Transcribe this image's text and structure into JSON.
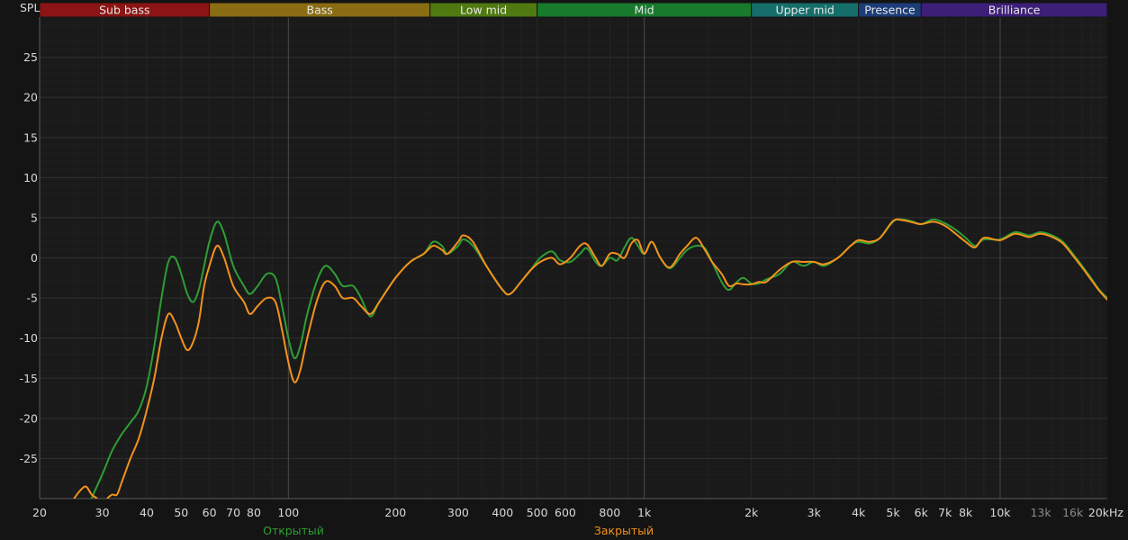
{
  "chart_data": {
    "type": "line",
    "y_axis_label": "SPL",
    "x_scale": "log",
    "xlim": [
      20,
      20000
    ],
    "ylim": [
      -30,
      30
    ],
    "grid": true,
    "bands": [
      {
        "label": "Sub bass",
        "from": 20,
        "to": 60,
        "color": "#8c1414"
      },
      {
        "label": "Bass",
        "from": 60,
        "to": 250,
        "color": "#8a6d12"
      },
      {
        "label": "Low mid",
        "from": 250,
        "to": 500,
        "color": "#4f7a12"
      },
      {
        "label": "Mid",
        "from": 500,
        "to": 2000,
        "color": "#187a2c"
      },
      {
        "label": "Upper mid",
        "from": 2000,
        "to": 4000,
        "color": "#156e6a"
      },
      {
        "label": "Presence",
        "from": 4000,
        "to": 6000,
        "color": "#1c3d78"
      },
      {
        "label": "Brilliance",
        "from": 6000,
        "to": 20000,
        "color": "#3d1f78"
      }
    ],
    "x_ticks": [
      {
        "value": 20,
        "label": "20"
      },
      {
        "value": 30,
        "label": "30"
      },
      {
        "value": 40,
        "label": "40"
      },
      {
        "value": 50,
        "label": "50"
      },
      {
        "value": 60,
        "label": "60"
      },
      {
        "value": 70,
        "label": "70"
      },
      {
        "value": 80,
        "label": "80"
      },
      {
        "value": 100,
        "label": "100"
      },
      {
        "value": 200,
        "label": "200"
      },
      {
        "value": 300,
        "label": "300"
      },
      {
        "value": 400,
        "label": "400"
      },
      {
        "value": 500,
        "label": "500"
      },
      {
        "value": 600,
        "label": "600"
      },
      {
        "value": 800,
        "label": "800"
      },
      {
        "value": 1000,
        "label": "1k"
      },
      {
        "value": 2000,
        "label": "2k"
      },
      {
        "value": 3000,
        "label": "3k"
      },
      {
        "value": 4000,
        "label": "4k"
      },
      {
        "value": 5000,
        "label": "5k"
      },
      {
        "value": 6000,
        "label": "6k"
      },
      {
        "value": 7000,
        "label": "7k"
      },
      {
        "value": 8000,
        "label": "8k"
      },
      {
        "value": 10000,
        "label": "10k"
      },
      {
        "value": 13000,
        "label": "13k",
        "dim": true
      },
      {
        "value": 16000,
        "label": "16k",
        "dim": true
      },
      {
        "value": 20000,
        "label": "20kHz"
      }
    ],
    "y_ticks": [
      25,
      20,
      15,
      10,
      5,
      0,
      -5,
      -10,
      -15,
      -20,
      -25
    ],
    "series": [
      {
        "name": "Открытый",
        "color": "#2e9e35",
        "points": [
          [
            26,
            -34
          ],
          [
            28,
            -30
          ],
          [
            30,
            -27
          ],
          [
            32,
            -24
          ],
          [
            34,
            -22
          ],
          [
            36,
            -20.5
          ],
          [
            38,
            -19
          ],
          [
            40,
            -16
          ],
          [
            42,
            -11
          ],
          [
            44,
            -5
          ],
          [
            46,
            -0.5
          ],
          [
            48,
            0
          ],
          [
            50,
            -2
          ],
          [
            52,
            -4.5
          ],
          [
            54,
            -5.5
          ],
          [
            56,
            -4
          ],
          [
            58,
            -1
          ],
          [
            60,
            2
          ],
          [
            63,
            4.5
          ],
          [
            66,
            3
          ],
          [
            70,
            -1
          ],
          [
            75,
            -3.5
          ],
          [
            78,
            -4.5
          ],
          [
            82,
            -3.5
          ],
          [
            87,
            -2
          ],
          [
            92,
            -2.5
          ],
          [
            96,
            -6
          ],
          [
            100,
            -10
          ],
          [
            104,
            -12.5
          ],
          [
            108,
            -11
          ],
          [
            113,
            -7
          ],
          [
            120,
            -3
          ],
          [
            127,
            -1
          ],
          [
            135,
            -2
          ],
          [
            142,
            -3.5
          ],
          [
            152,
            -3.5
          ],
          [
            160,
            -5
          ],
          [
            170,
            -7.3
          ],
          [
            180,
            -5.5
          ],
          [
            200,
            -2.5
          ],
          [
            220,
            -0.5
          ],
          [
            240,
            0.5
          ],
          [
            255,
            2
          ],
          [
            270,
            1.5
          ],
          [
            280,
            0.5
          ],
          [
            300,
            1.5
          ],
          [
            310,
            2.3
          ],
          [
            330,
            1.5
          ],
          [
            360,
            -1
          ],
          [
            400,
            -4
          ],
          [
            420,
            -4.5
          ],
          [
            450,
            -3
          ],
          [
            480,
            -1.5
          ],
          [
            510,
            0
          ],
          [
            550,
            0.8
          ],
          [
            580,
            -0.3
          ],
          [
            620,
            -0.5
          ],
          [
            660,
            0.5
          ],
          [
            690,
            1.2
          ],
          [
            730,
            -0.5
          ],
          [
            760,
            -1
          ],
          [
            800,
            0
          ],
          [
            840,
            -0.3
          ],
          [
            880,
            1.3
          ],
          [
            920,
            2.5
          ],
          [
            960,
            1.5
          ],
          [
            1000,
            0.5
          ],
          [
            1050,
            2
          ],
          [
            1110,
            0
          ],
          [
            1180,
            -1.3
          ],
          [
            1260,
            0
          ],
          [
            1320,
            1
          ],
          [
            1400,
            1.5
          ],
          [
            1480,
            1.2
          ],
          [
            1550,
            -0.5
          ],
          [
            1650,
            -3
          ],
          [
            1730,
            -4
          ],
          [
            1820,
            -3
          ],
          [
            1900,
            -2.5
          ],
          [
            2000,
            -3.2
          ],
          [
            2100,
            -3.2
          ],
          [
            2200,
            -2.7
          ],
          [
            2400,
            -2
          ],
          [
            2600,
            -0.5
          ],
          [
            2800,
            -1
          ],
          [
            3000,
            -0.5
          ],
          [
            3200,
            -1
          ],
          [
            3500,
            0
          ],
          [
            3800,
            1.5
          ],
          [
            4000,
            2
          ],
          [
            4300,
            1.8
          ],
          [
            4600,
            2.5
          ],
          [
            5000,
            4.5
          ],
          [
            5300,
            4.8
          ],
          [
            5700,
            4.5
          ],
          [
            6000,
            4.2
          ],
          [
            6500,
            4.8
          ],
          [
            7000,
            4.3
          ],
          [
            7500,
            3.5
          ],
          [
            8000,
            2.5
          ],
          [
            8500,
            1.5
          ],
          [
            9000,
            2.3
          ],
          [
            10000,
            2.3
          ],
          [
            11000,
            3.2
          ],
          [
            12000,
            2.8
          ],
          [
            12500,
            3
          ],
          [
            13000,
            3.2
          ],
          [
            14000,
            2.8
          ],
          [
            15000,
            2
          ],
          [
            16000,
            0.5
          ],
          [
            17000,
            -1
          ],
          [
            18000,
            -2.5
          ],
          [
            19000,
            -4
          ],
          [
            20000,
            -5
          ]
        ]
      },
      {
        "name": "Закрытый",
        "color": "#f2921d",
        "points": [
          [
            25,
            -30
          ],
          [
            26,
            -29
          ],
          [
            27,
            -28.5
          ],
          [
            28,
            -29.5
          ],
          [
            29,
            -30
          ],
          [
            30,
            -31
          ],
          [
            31,
            -30
          ],
          [
            32,
            -29.5
          ],
          [
            33,
            -29.5
          ],
          [
            34,
            -28
          ],
          [
            36,
            -25
          ],
          [
            38,
            -22.5
          ],
          [
            40,
            -19
          ],
          [
            42,
            -15
          ],
          [
            44,
            -10
          ],
          [
            46,
            -7
          ],
          [
            48,
            -8
          ],
          [
            50,
            -10
          ],
          [
            52,
            -11.5
          ],
          [
            54,
            -10.5
          ],
          [
            56,
            -8
          ],
          [
            58,
            -3.5
          ],
          [
            60,
            -1
          ],
          [
            63,
            1.5
          ],
          [
            66,
            0
          ],
          [
            70,
            -3.5
          ],
          [
            75,
            -5.5
          ],
          [
            78,
            -7
          ],
          [
            82,
            -6
          ],
          [
            87,
            -5
          ],
          [
            92,
            -5.5
          ],
          [
            96,
            -9
          ],
          [
            100,
            -13
          ],
          [
            104,
            -15.5
          ],
          [
            108,
            -14
          ],
          [
            113,
            -10
          ],
          [
            120,
            -5.5
          ],
          [
            127,
            -3
          ],
          [
            135,
            -3.5
          ],
          [
            142,
            -5
          ],
          [
            152,
            -5
          ],
          [
            160,
            -6
          ],
          [
            170,
            -7
          ],
          [
            180,
            -5.5
          ],
          [
            200,
            -2.5
          ],
          [
            220,
            -0.5
          ],
          [
            240,
            0.5
          ],
          [
            255,
            1.5
          ],
          [
            270,
            1
          ],
          [
            280,
            0.5
          ],
          [
            300,
            2
          ],
          [
            310,
            2.8
          ],
          [
            330,
            2
          ],
          [
            360,
            -1
          ],
          [
            400,
            -4
          ],
          [
            420,
            -4.5
          ],
          [
            450,
            -3
          ],
          [
            480,
            -1.5
          ],
          [
            510,
            -0.5
          ],
          [
            550,
            0
          ],
          [
            580,
            -0.8
          ],
          [
            620,
            0
          ],
          [
            660,
            1.5
          ],
          [
            690,
            1.7
          ],
          [
            730,
            0
          ],
          [
            760,
            -1
          ],
          [
            800,
            0.5
          ],
          [
            840,
            0.5
          ],
          [
            880,
            0
          ],
          [
            920,
            1.8
          ],
          [
            960,
            2.2
          ],
          [
            1000,
            0.5
          ],
          [
            1050,
            2
          ],
          [
            1110,
            0
          ],
          [
            1180,
            -1.2
          ],
          [
            1260,
            0.5
          ],
          [
            1320,
            1.5
          ],
          [
            1400,
            2.5
          ],
          [
            1480,
            1
          ],
          [
            1550,
            -0.5
          ],
          [
            1650,
            -2
          ],
          [
            1730,
            -3.5
          ],
          [
            1820,
            -3.2
          ],
          [
            1900,
            -3.3
          ],
          [
            2000,
            -3.3
          ],
          [
            2100,
            -3
          ],
          [
            2200,
            -3
          ],
          [
            2400,
            -1.5
          ],
          [
            2600,
            -0.5
          ],
          [
            2800,
            -0.5
          ],
          [
            3000,
            -0.5
          ],
          [
            3200,
            -0.8
          ],
          [
            3500,
            0
          ],
          [
            3800,
            1.5
          ],
          [
            4000,
            2.2
          ],
          [
            4300,
            2
          ],
          [
            4600,
            2.5
          ],
          [
            5000,
            4.6
          ],
          [
            5300,
            4.7
          ],
          [
            5700,
            4.4
          ],
          [
            6000,
            4.2
          ],
          [
            6500,
            4.5
          ],
          [
            7000,
            4
          ],
          [
            7500,
            3
          ],
          [
            8000,
            2
          ],
          [
            8500,
            1.3
          ],
          [
            9000,
            2.5
          ],
          [
            10000,
            2.2
          ],
          [
            11000,
            3
          ],
          [
            12000,
            2.6
          ],
          [
            12500,
            2.8
          ],
          [
            13000,
            3
          ],
          [
            14000,
            2.6
          ],
          [
            15000,
            1.8
          ],
          [
            16000,
            0.3
          ],
          [
            17000,
            -1.2
          ],
          [
            18000,
            -2.7
          ],
          [
            19000,
            -4.1
          ],
          [
            20000,
            -5.2
          ]
        ]
      }
    ]
  }
}
